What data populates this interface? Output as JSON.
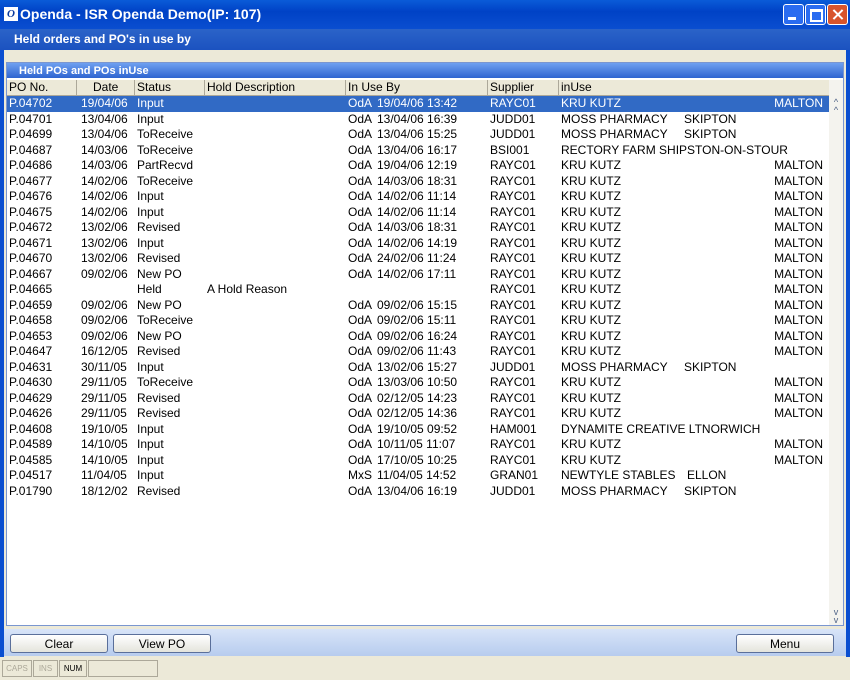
{
  "window": {
    "title": "Openda  -  ISR Openda Demo(IP: 107)"
  },
  "header": {
    "title": "Held orders and PO's in use by"
  },
  "panel": {
    "title": "Held POs and POs inUse"
  },
  "columns": [
    "PO No.",
    "Date",
    "Status",
    "Hold Description",
    "In Use By",
    "Supplier",
    "inUse"
  ],
  "rows": [
    {
      "po": "P.04702",
      "date": "19/04/06",
      "status": "Input",
      "hold": "",
      "user": "OdA",
      "inuse": "19/04/06 13:42",
      "supplier": "RAYC01",
      "name": "KRU KUTZ",
      "town": "MALTON",
      "selected": true
    },
    {
      "po": "P.04701",
      "date": "13/04/06",
      "status": "Input",
      "hold": "",
      "user": "OdA",
      "inuse": "13/04/06 16:39",
      "supplier": "JUDD01",
      "name": "MOSS PHARMACY",
      "town": "SKIPTON"
    },
    {
      "po": "P.04699",
      "date": "13/04/06",
      "status": "ToReceive",
      "hold": "",
      "user": "OdA",
      "inuse": "13/04/06 15:25",
      "supplier": "JUDD01",
      "name": "MOSS PHARMACY",
      "town": "SKIPTON"
    },
    {
      "po": "P.04687",
      "date": "14/03/06",
      "status": "ToReceive",
      "hold": "",
      "user": "OdA",
      "inuse": "13/04/06 16:17",
      "supplier": "BSI001",
      "name": "RECTORY FARM SHIPSTON-ON-STOUR",
      "town": ""
    },
    {
      "po": "P.04686",
      "date": "14/03/06",
      "status": "PartRecvd",
      "hold": "",
      "user": "OdA",
      "inuse": "19/04/06 12:19",
      "supplier": "RAYC01",
      "name": "KRU KUTZ",
      "town": "MALTON"
    },
    {
      "po": "P.04677",
      "date": "14/02/06",
      "status": "ToReceive",
      "hold": "",
      "user": "OdA",
      "inuse": "14/03/06 18:31",
      "supplier": "RAYC01",
      "name": "KRU KUTZ",
      "town": "MALTON"
    },
    {
      "po": "P.04676",
      "date": "14/02/06",
      "status": "Input",
      "hold": "",
      "user": "OdA",
      "inuse": "14/02/06 11:14",
      "supplier": "RAYC01",
      "name": "KRU KUTZ",
      "town": "MALTON"
    },
    {
      "po": "P.04675",
      "date": "14/02/06",
      "status": "Input",
      "hold": "",
      "user": "OdA",
      "inuse": "14/02/06 11:14",
      "supplier": "RAYC01",
      "name": "KRU KUTZ",
      "town": "MALTON"
    },
    {
      "po": "P.04672",
      "date": "13/02/06",
      "status": "Revised",
      "hold": "",
      "user": "OdA",
      "inuse": "14/03/06 18:31",
      "supplier": "RAYC01",
      "name": "KRU KUTZ",
      "town": "MALTON"
    },
    {
      "po": "P.04671",
      "date": "13/02/06",
      "status": "Input",
      "hold": "",
      "user": "OdA",
      "inuse": "14/02/06 14:19",
      "supplier": "RAYC01",
      "name": "KRU KUTZ",
      "town": "MALTON"
    },
    {
      "po": "P.04670",
      "date": "13/02/06",
      "status": "Revised",
      "hold": "",
      "user": "OdA",
      "inuse": "24/02/06 11:24",
      "supplier": "RAYC01",
      "name": "KRU KUTZ",
      "town": "MALTON"
    },
    {
      "po": "P.04667",
      "date": "09/02/06",
      "status": "New PO",
      "hold": "",
      "user": "OdA",
      "inuse": "14/02/06 17:11",
      "supplier": "RAYC01",
      "name": "KRU KUTZ",
      "town": "MALTON"
    },
    {
      "po": "P.04665",
      "date": "",
      "status": "Held",
      "hold": "A Hold Reason",
      "user": "",
      "inuse": "",
      "supplier": "RAYC01",
      "name": "KRU KUTZ",
      "town": "MALTON"
    },
    {
      "po": "P.04659",
      "date": "09/02/06",
      "status": "New PO",
      "hold": "",
      "user": "OdA",
      "inuse": "09/02/06 15:15",
      "supplier": "RAYC01",
      "name": "KRU KUTZ",
      "town": "MALTON"
    },
    {
      "po": "P.04658",
      "date": "09/02/06",
      "status": "ToReceive",
      "hold": "",
      "user": "OdA",
      "inuse": "09/02/06 15:11",
      "supplier": "RAYC01",
      "name": "KRU KUTZ",
      "town": "MALTON"
    },
    {
      "po": "P.04653",
      "date": "09/02/06",
      "status": "New PO",
      "hold": "",
      "user": "OdA",
      "inuse": "09/02/06 16:24",
      "supplier": "RAYC01",
      "name": "KRU KUTZ",
      "town": "MALTON"
    },
    {
      "po": "P.04647",
      "date": "16/12/05",
      "status": "Revised",
      "hold": "",
      "user": "OdA",
      "inuse": "09/02/06 11:43",
      "supplier": "RAYC01",
      "name": "KRU KUTZ",
      "town": "MALTON"
    },
    {
      "po": "P.04631",
      "date": "30/11/05",
      "status": "Input",
      "hold": "",
      "user": "OdA",
      "inuse": "13/02/06 15:27",
      "supplier": "JUDD01",
      "name": "MOSS PHARMACY",
      "town": "SKIPTON"
    },
    {
      "po": "P.04630",
      "date": "29/11/05",
      "status": "ToReceive",
      "hold": "",
      "user": "OdA",
      "inuse": "13/03/06 10:50",
      "supplier": "RAYC01",
      "name": "KRU KUTZ",
      "town": "MALTON"
    },
    {
      "po": "P.04629",
      "date": "29/11/05",
      "status": "Revised",
      "hold": "",
      "user": "OdA",
      "inuse": "02/12/05 14:23",
      "supplier": "RAYC01",
      "name": "KRU KUTZ",
      "town": "MALTON"
    },
    {
      "po": "P.04626",
      "date": "29/11/05",
      "status": "Revised",
      "hold": "",
      "user": "OdA",
      "inuse": "02/12/05 14:36",
      "supplier": "RAYC01",
      "name": "KRU KUTZ",
      "town": "MALTON"
    },
    {
      "po": "P.04608",
      "date": "19/10/05",
      "status": "Input",
      "hold": "",
      "user": "OdA",
      "inuse": "19/10/05 09:52",
      "supplier": "HAM001",
      "name": "DYNAMITE CREATIVE LTNORWICH",
      "town": ""
    },
    {
      "po": "P.04589",
      "date": "14/10/05",
      "status": "Input",
      "hold": "",
      "user": "OdA",
      "inuse": "10/11/05 11:07",
      "supplier": "RAYC01",
      "name": "KRU KUTZ",
      "town": "MALTON"
    },
    {
      "po": "P.04585",
      "date": "14/10/05",
      "status": "Input",
      "hold": "",
      "user": "OdA",
      "inuse": "17/10/05 10:25",
      "supplier": "RAYC01",
      "name": "KRU KUTZ",
      "town": "MALTON"
    },
    {
      "po": "P.04517",
      "date": "11/04/05",
      "status": "Input",
      "hold": "",
      "user": "MxS",
      "inuse": "11/04/05 14:52",
      "supplier": "GRAN01",
      "name": "NEWTYLE STABLES",
      "town": "ELLON"
    },
    {
      "po": "P.01790",
      "date": "18/12/02",
      "status": "Revised",
      "hold": "",
      "user": "OdA",
      "inuse": "13/04/06 16:19",
      "supplier": "JUDD01",
      "name": "MOSS PHARMACY",
      "town": "SKIPTON"
    }
  ],
  "buttons": {
    "clear": "Clear",
    "view_po": "View PO",
    "menu": "Menu"
  },
  "status": {
    "caps": "CAPS",
    "ins": "INS",
    "num": "NUM"
  }
}
